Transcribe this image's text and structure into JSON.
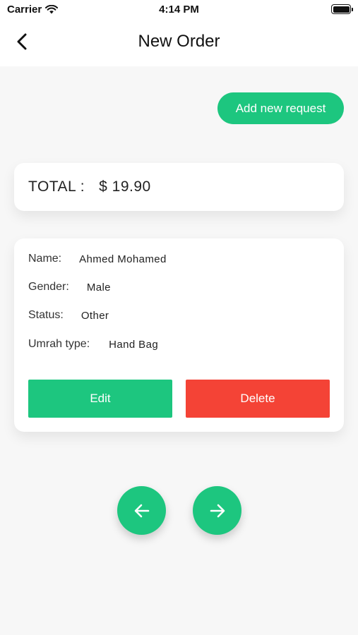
{
  "status_bar": {
    "carrier": "Carrier",
    "time": "4:14 PM"
  },
  "nav": {
    "title": "New Order",
    "back_icon": "chevron-left-icon"
  },
  "actions": {
    "add_new_request": "Add new request"
  },
  "total": {
    "label": "TOTAL :",
    "amount": "$ 19.90"
  },
  "order": {
    "fields": [
      {
        "label": "Name:",
        "value": "Ahmed Mohamed"
      },
      {
        "label": "Gender:",
        "value": "Male"
      },
      {
        "label": "Status:",
        "value": "Other"
      },
      {
        "label": "Umrah type:",
        "value": "Hand Bag"
      }
    ],
    "edit_label": "Edit",
    "delete_label": "Delete"
  },
  "pagination": {
    "prev_icon": "arrow-left-icon",
    "next_icon": "arrow-right-icon"
  },
  "colors": {
    "accent": "#1dc67f",
    "danger": "#f44336",
    "background": "#f7f7f7"
  }
}
